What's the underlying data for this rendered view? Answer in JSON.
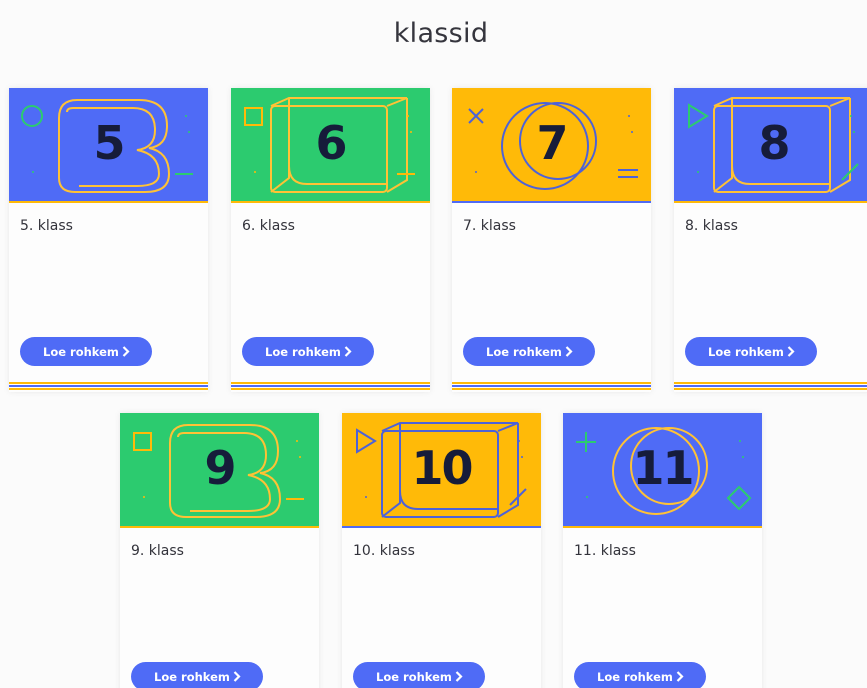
{
  "page": {
    "title": "klassid"
  },
  "colors": {
    "blue": "#4f6bf6",
    "green": "#2ccb6f",
    "yellow": "#ffba08",
    "dark": "#161c3a",
    "outline_yellow": "#ffc235",
    "outline_blue": "#4d62d8"
  },
  "cards": [
    {
      "number": "5",
      "title": "5. klass",
      "button_label": "Loe rohkem",
      "bg": "blue",
      "shape": "circle-icon",
      "deco": "letter-b"
    },
    {
      "number": "6",
      "title": "6. klass",
      "button_label": "Loe rohkem",
      "bg": "green",
      "shape": "square-icon",
      "deco": "cube"
    },
    {
      "number": "7",
      "title": "7. klass",
      "button_label": "Loe rohkem",
      "bg": "yellow",
      "shape": "cross-icon",
      "deco": "rings"
    },
    {
      "number": "8",
      "title": "8. klass",
      "button_label": "Loe rohkem",
      "bg": "blue",
      "shape": "triangle-icon",
      "deco": "cube"
    },
    {
      "number": "9",
      "title": "9. klass",
      "button_label": "Loe rohkem",
      "bg": "green",
      "shape": "square-icon",
      "deco": "letter-b"
    },
    {
      "number": "10",
      "title": "10. klass",
      "button_label": "Loe rohkem",
      "bg": "yellow",
      "shape": "triangle-icon",
      "deco": "cube"
    },
    {
      "number": "11",
      "title": "11. klass",
      "button_label": "Loe rohkem",
      "bg": "blue",
      "shape": "plus-icon",
      "deco": "rings"
    }
  ]
}
